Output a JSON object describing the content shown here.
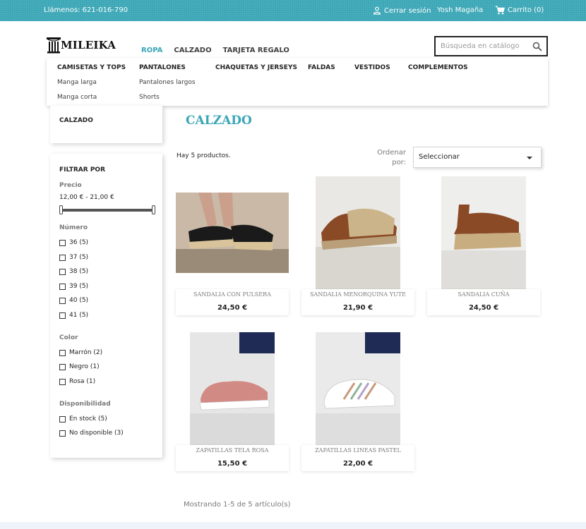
{
  "topbar": {
    "phone": "Llámenos: 621-016-790",
    "signout": "Cerrar sesión",
    "username": "Yosh Magaña",
    "cart": "Carrito (0)"
  },
  "header": {
    "logo": "MILEIKA",
    "nav": [
      "ROPA",
      "CALZADO",
      "TARJETA REGALO"
    ],
    "search_placeholder": "Búsqueda en catálogo"
  },
  "megamenu": {
    "columns": [
      {
        "title": "CAMISETAS Y TOPS",
        "items": [
          "Manga larga",
          "Manga corta"
        ]
      },
      {
        "title": "PANTALONES",
        "items": [
          "Pantalones largos",
          "Shorts"
        ]
      },
      {
        "title": "CHAQUETAS Y JERSEYS",
        "items": []
      },
      {
        "title": "FALDAS",
        "items": []
      },
      {
        "title": "VESTIDOS",
        "items": []
      },
      {
        "title": "COMPLEMENTOS",
        "items": []
      }
    ]
  },
  "sidebar": {
    "category": "CALZADO",
    "filter_title": "FILTRAR POR",
    "price_label": "Precio",
    "price_range": "12,00 € - 21,00 €",
    "number_label": "Número",
    "numbers": [
      "36 (5)",
      "37 (5)",
      "38 (5)",
      "39 (5)",
      "40 (5)",
      "41 (5)"
    ],
    "color_label": "Color",
    "colors": [
      "Marrón (2)",
      "Negro (1)",
      "Rosa (1)"
    ],
    "availability_label": "Disponibilidad",
    "availability": [
      "En stock (5)",
      "No disponible (3)"
    ]
  },
  "main": {
    "title": "CALZADO",
    "count": "Hay 5 productos.",
    "sort_label": "Ordenar por:",
    "sort_value": "Seleccionar",
    "showing": "Mostrando 1-5 de 5 artículo(s)"
  },
  "products": [
    {
      "name": "SANDALIA CON PULSERA",
      "price": "24,50 €"
    },
    {
      "name": "SANDALIA MENORQUINA YUTE",
      "price": "21,90 €"
    },
    {
      "name": "SANDALIA CUÑA",
      "price": "24,50 €"
    },
    {
      "name": "ZAPATILLAS TELA ROSA",
      "price": "15,50 €"
    },
    {
      "name": "ZAPATILLAS LINEAS PASTEL",
      "price": "22,00 €"
    }
  ],
  "colors": {
    "accent": "#3aa6b6",
    "text": "#232323",
    "muted": "#7a7a7a"
  }
}
